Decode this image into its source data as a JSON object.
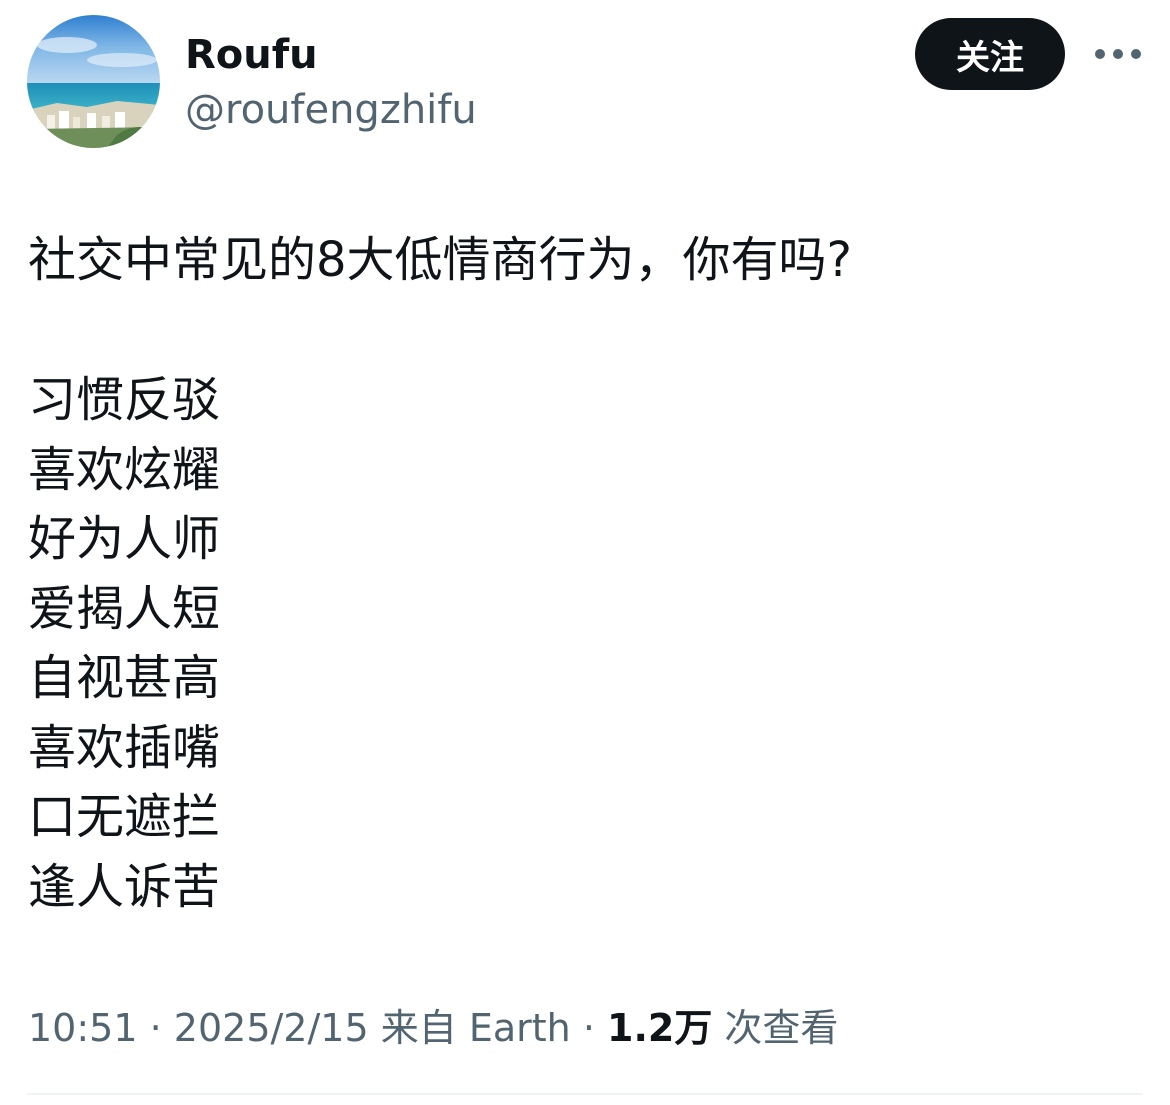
{
  "author": {
    "display_name": "Roufu",
    "handle": "@roufengzhifu"
  },
  "actions": {
    "follow_label": "关注",
    "more_icon": "more-horizontal-icon"
  },
  "tweet": {
    "title": "社交中常见的8大低情商行为，你有吗?",
    "lines": [
      "习惯反驳",
      "喜欢炫耀",
      "好为人师",
      "爱揭人短",
      "自视甚高",
      "喜欢插嘴",
      "口无遮拦",
      "逢人诉苦"
    ]
  },
  "meta": {
    "time": "10:51",
    "separator": "·",
    "date": "2025/2/15",
    "source": "来自 Earth",
    "views_count": "1.2万",
    "views_label": "次查看"
  },
  "colors": {
    "text_primary": "#0f1419",
    "text_secondary": "#536471",
    "follow_bg": "#0f1419",
    "follow_text": "#ffffff",
    "divider": "#eff3f4"
  }
}
